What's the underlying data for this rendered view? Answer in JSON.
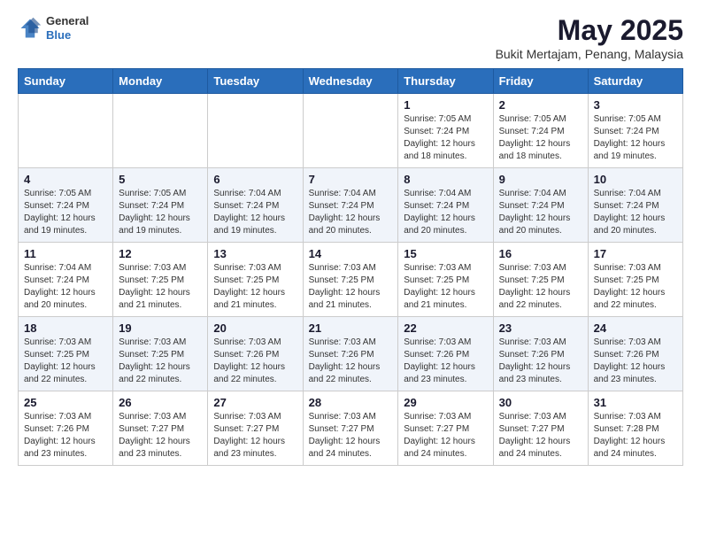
{
  "header": {
    "logo_general": "General",
    "logo_blue": "Blue",
    "month_title": "May 2025",
    "location": "Bukit Mertajam, Penang, Malaysia"
  },
  "days_of_week": [
    "Sunday",
    "Monday",
    "Tuesday",
    "Wednesday",
    "Thursday",
    "Friday",
    "Saturday"
  ],
  "weeks": [
    [
      {
        "day": "",
        "info": ""
      },
      {
        "day": "",
        "info": ""
      },
      {
        "day": "",
        "info": ""
      },
      {
        "day": "",
        "info": ""
      },
      {
        "day": "1",
        "info": "Sunrise: 7:05 AM\nSunset: 7:24 PM\nDaylight: 12 hours\nand 18 minutes."
      },
      {
        "day": "2",
        "info": "Sunrise: 7:05 AM\nSunset: 7:24 PM\nDaylight: 12 hours\nand 18 minutes."
      },
      {
        "day": "3",
        "info": "Sunrise: 7:05 AM\nSunset: 7:24 PM\nDaylight: 12 hours\nand 19 minutes."
      }
    ],
    [
      {
        "day": "4",
        "info": "Sunrise: 7:05 AM\nSunset: 7:24 PM\nDaylight: 12 hours\nand 19 minutes."
      },
      {
        "day": "5",
        "info": "Sunrise: 7:05 AM\nSunset: 7:24 PM\nDaylight: 12 hours\nand 19 minutes."
      },
      {
        "day": "6",
        "info": "Sunrise: 7:04 AM\nSunset: 7:24 PM\nDaylight: 12 hours\nand 19 minutes."
      },
      {
        "day": "7",
        "info": "Sunrise: 7:04 AM\nSunset: 7:24 PM\nDaylight: 12 hours\nand 20 minutes."
      },
      {
        "day": "8",
        "info": "Sunrise: 7:04 AM\nSunset: 7:24 PM\nDaylight: 12 hours\nand 20 minutes."
      },
      {
        "day": "9",
        "info": "Sunrise: 7:04 AM\nSunset: 7:24 PM\nDaylight: 12 hours\nand 20 minutes."
      },
      {
        "day": "10",
        "info": "Sunrise: 7:04 AM\nSunset: 7:24 PM\nDaylight: 12 hours\nand 20 minutes."
      }
    ],
    [
      {
        "day": "11",
        "info": "Sunrise: 7:04 AM\nSunset: 7:24 PM\nDaylight: 12 hours\nand 20 minutes."
      },
      {
        "day": "12",
        "info": "Sunrise: 7:03 AM\nSunset: 7:25 PM\nDaylight: 12 hours\nand 21 minutes."
      },
      {
        "day": "13",
        "info": "Sunrise: 7:03 AM\nSunset: 7:25 PM\nDaylight: 12 hours\nand 21 minutes."
      },
      {
        "day": "14",
        "info": "Sunrise: 7:03 AM\nSunset: 7:25 PM\nDaylight: 12 hours\nand 21 minutes."
      },
      {
        "day": "15",
        "info": "Sunrise: 7:03 AM\nSunset: 7:25 PM\nDaylight: 12 hours\nand 21 minutes."
      },
      {
        "day": "16",
        "info": "Sunrise: 7:03 AM\nSunset: 7:25 PM\nDaylight: 12 hours\nand 22 minutes."
      },
      {
        "day": "17",
        "info": "Sunrise: 7:03 AM\nSunset: 7:25 PM\nDaylight: 12 hours\nand 22 minutes."
      }
    ],
    [
      {
        "day": "18",
        "info": "Sunrise: 7:03 AM\nSunset: 7:25 PM\nDaylight: 12 hours\nand 22 minutes."
      },
      {
        "day": "19",
        "info": "Sunrise: 7:03 AM\nSunset: 7:25 PM\nDaylight: 12 hours\nand 22 minutes."
      },
      {
        "day": "20",
        "info": "Sunrise: 7:03 AM\nSunset: 7:26 PM\nDaylight: 12 hours\nand 22 minutes."
      },
      {
        "day": "21",
        "info": "Sunrise: 7:03 AM\nSunset: 7:26 PM\nDaylight: 12 hours\nand 22 minutes."
      },
      {
        "day": "22",
        "info": "Sunrise: 7:03 AM\nSunset: 7:26 PM\nDaylight: 12 hours\nand 23 minutes."
      },
      {
        "day": "23",
        "info": "Sunrise: 7:03 AM\nSunset: 7:26 PM\nDaylight: 12 hours\nand 23 minutes."
      },
      {
        "day": "24",
        "info": "Sunrise: 7:03 AM\nSunset: 7:26 PM\nDaylight: 12 hours\nand 23 minutes."
      }
    ],
    [
      {
        "day": "25",
        "info": "Sunrise: 7:03 AM\nSunset: 7:26 PM\nDaylight: 12 hours\nand 23 minutes."
      },
      {
        "day": "26",
        "info": "Sunrise: 7:03 AM\nSunset: 7:27 PM\nDaylight: 12 hours\nand 23 minutes."
      },
      {
        "day": "27",
        "info": "Sunrise: 7:03 AM\nSunset: 7:27 PM\nDaylight: 12 hours\nand 23 minutes."
      },
      {
        "day": "28",
        "info": "Sunrise: 7:03 AM\nSunset: 7:27 PM\nDaylight: 12 hours\nand 24 minutes."
      },
      {
        "day": "29",
        "info": "Sunrise: 7:03 AM\nSunset: 7:27 PM\nDaylight: 12 hours\nand 24 minutes."
      },
      {
        "day": "30",
        "info": "Sunrise: 7:03 AM\nSunset: 7:27 PM\nDaylight: 12 hours\nand 24 minutes."
      },
      {
        "day": "31",
        "info": "Sunrise: 7:03 AM\nSunset: 7:28 PM\nDaylight: 12 hours\nand 24 minutes."
      }
    ]
  ]
}
